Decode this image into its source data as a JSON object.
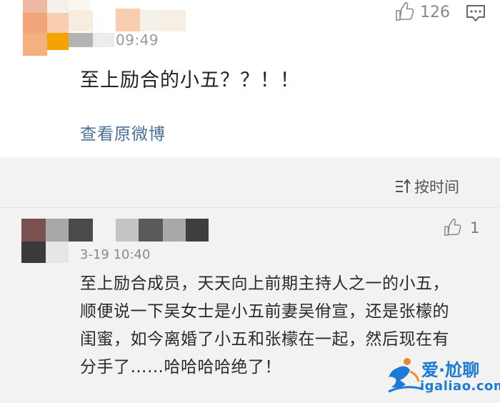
{
  "post": {
    "time": "09:49",
    "like_count": "126",
    "text": "至上励合的小五？？！！",
    "view_original": "查看原微博"
  },
  "sort": {
    "label": "按时间"
  },
  "comment": {
    "time": "3-19 10:40",
    "like_count": "1",
    "text": "至上励合成员，天天向上前期主持人之一的小五，顺便说一下吴女士是小五前妻吴佾宣，还是张檬的闺蜜，如今离婚了小五和张檬在一起，然后现在有分手了……哈哈哈哈绝了！"
  },
  "watermark": {
    "name": "爱·尬聊",
    "url": "igaliao.com"
  },
  "colors": {
    "link": "#4a6f98",
    "watermark": "#1d7bd6",
    "comment_bg": "#f2f2f2"
  },
  "icons": [
    "thumbs-up-icon",
    "comment-icon",
    "sort-time-icon",
    "watermark-logo"
  ]
}
